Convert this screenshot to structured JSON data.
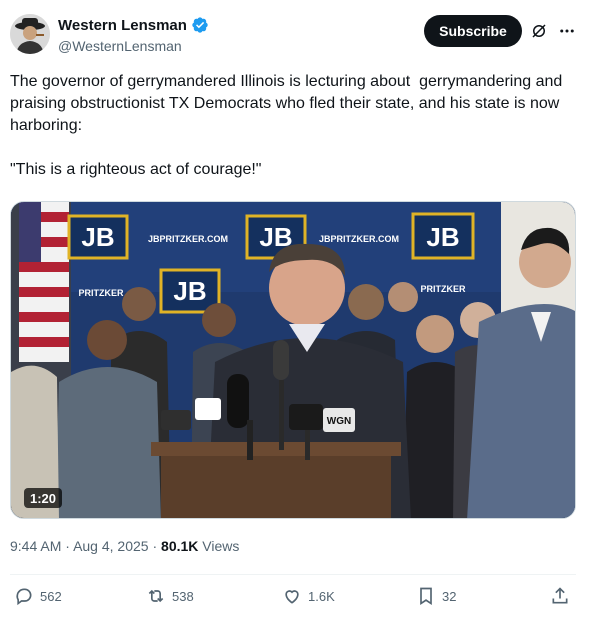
{
  "author": {
    "display_name": "Western Lensman",
    "handle": "@WesternLensman",
    "verified": true
  },
  "header": {
    "subscribe_label": "Subscribe",
    "icons": [
      "grok-icon",
      "more-icon"
    ]
  },
  "tweet": {
    "text": "The governor of gerrymandered Illinois is lecturing about  gerrymandering and praising obstructionist TX Democrats who fled their state, and his state is now harboring:\n\n\"This is a righteous act of courage!\"",
    "video_duration": "1:20"
  },
  "media": {
    "backdrop_logo": "JB",
    "backdrop_url": "JBPRITZKER.COM",
    "backdrop_short": "PRITZKER",
    "mic_flag": "WGN"
  },
  "meta": {
    "time": "9:44 AM",
    "separator": "·",
    "date": "Aug 4, 2025",
    "views_count": "80.1K",
    "views_label": "Views"
  },
  "actions": {
    "replies": "562",
    "reposts": "538",
    "likes": "1.6K",
    "bookmarks": "32"
  },
  "colors": {
    "text": "#0f1419",
    "secondary": "#536471",
    "verified_blue": "#1d9bf0",
    "backdrop_navy": "#1f3a6e",
    "logo_gold": "#e0b326"
  }
}
